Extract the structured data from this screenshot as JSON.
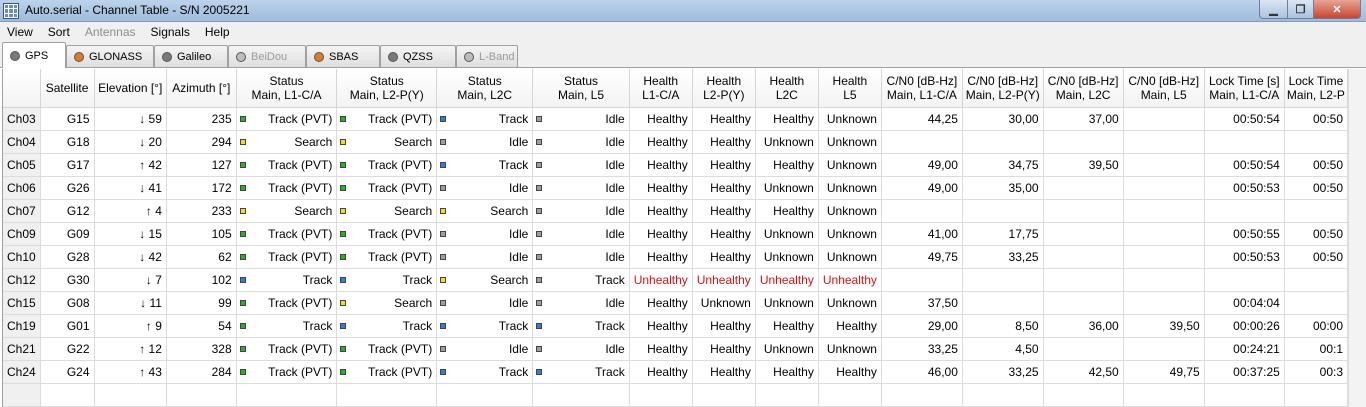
{
  "window": {
    "title": "Auto.serial - Channel Table - S/N 2005221"
  },
  "menu": [
    {
      "label": "View",
      "disabled": false
    },
    {
      "label": "Sort",
      "disabled": false
    },
    {
      "label": "Antennas",
      "disabled": true
    },
    {
      "label": "Signals",
      "disabled": false
    },
    {
      "label": "Help",
      "disabled": false
    }
  ],
  "tabs": [
    {
      "label": "GPS",
      "color": "#7a7a7a",
      "active": true,
      "disabled": false
    },
    {
      "label": "GLONASS",
      "color": "#e07a2a",
      "active": false,
      "disabled": false
    },
    {
      "label": "Galileo",
      "color": "#7a7a7a",
      "active": false,
      "disabled": false
    },
    {
      "label": "BeiDou",
      "color": "#bdbdbd",
      "active": false,
      "disabled": true
    },
    {
      "label": "SBAS",
      "color": "#e07a2a",
      "active": false,
      "disabled": false
    },
    {
      "label": "QZSS",
      "color": "#7a7a7a",
      "active": false,
      "disabled": false
    },
    {
      "label": "L-Band",
      "color": "#bdbdbd",
      "active": false,
      "disabled": true
    }
  ],
  "status_colors": {
    "green": "#21b521",
    "yellow": "#f0e020",
    "blue": "#2a7fdb",
    "gray": "#9e9e9e"
  },
  "columns": [
    [
      "",
      ""
    ],
    [
      "Satellite",
      ""
    ],
    [
      "Elevation [°]",
      ""
    ],
    [
      "Azimuth [°]",
      ""
    ],
    [
      "Status",
      "Main, L1-C/A"
    ],
    [
      "Status",
      "Main, L2-P(Y)"
    ],
    [
      "Status",
      "Main, L2C"
    ],
    [
      "Status",
      "Main, L5"
    ],
    [
      "Health",
      "L1-C/A"
    ],
    [
      "Health",
      "L2-P(Y)"
    ],
    [
      "Health",
      "L2C"
    ],
    [
      "Health",
      "L5"
    ],
    [
      "C/N0 [dB-Hz]",
      "Main, L1-C/A"
    ],
    [
      "C/N0 [dB-Hz]",
      "Main, L2-P(Y)"
    ],
    [
      "C/N0 [dB-Hz]",
      "Main, L2C"
    ],
    [
      "C/N0 [dB-Hz]",
      "Main, L5"
    ],
    [
      "Lock Time [s]",
      "Main, L1-C/A"
    ],
    [
      "Lock Time",
      "Main, L2-P"
    ]
  ],
  "rows": [
    {
      "ch": "Ch03",
      "sat": "G15",
      "elev": "↓ 59",
      "az": "235",
      "st": [
        [
          "green",
          "Track (PVT)"
        ],
        [
          "green",
          "Track (PVT)"
        ],
        [
          "blue",
          "Track"
        ],
        [
          "gray",
          "Idle"
        ]
      ],
      "health": [
        "Healthy",
        "Healthy",
        "Healthy",
        "Unknown"
      ],
      "cn0": [
        "44,25",
        "30,00",
        "37,00",
        ""
      ],
      "lock": [
        "00:50:54",
        "00:50"
      ]
    },
    {
      "ch": "Ch04",
      "sat": "G18",
      "elev": "↓ 20",
      "az": "294",
      "st": [
        [
          "yellow",
          "Search"
        ],
        [
          "yellow",
          "Search"
        ],
        [
          "gray",
          "Idle"
        ],
        [
          "gray",
          "Idle"
        ]
      ],
      "health": [
        "Healthy",
        "Healthy",
        "Unknown",
        "Unknown"
      ],
      "cn0": [
        "",
        "",
        "",
        ""
      ],
      "lock": [
        "",
        ""
      ]
    },
    {
      "ch": "Ch05",
      "sat": "G17",
      "elev": "↑ 42",
      "az": "127",
      "st": [
        [
          "green",
          "Track (PVT)"
        ],
        [
          "green",
          "Track (PVT)"
        ],
        [
          "blue",
          "Track"
        ],
        [
          "gray",
          "Idle"
        ]
      ],
      "health": [
        "Healthy",
        "Healthy",
        "Healthy",
        "Unknown"
      ],
      "cn0": [
        "49,00",
        "34,75",
        "39,50",
        ""
      ],
      "lock": [
        "00:50:54",
        "00:50"
      ]
    },
    {
      "ch": "Ch06",
      "sat": "G26",
      "elev": "↓ 41",
      "az": "172",
      "st": [
        [
          "green",
          "Track (PVT)"
        ],
        [
          "green",
          "Track (PVT)"
        ],
        [
          "gray",
          "Idle"
        ],
        [
          "gray",
          "Idle"
        ]
      ],
      "health": [
        "Healthy",
        "Healthy",
        "Unknown",
        "Unknown"
      ],
      "cn0": [
        "49,00",
        "35,00",
        "",
        ""
      ],
      "lock": [
        "00:50:53",
        "00:50"
      ]
    },
    {
      "ch": "Ch07",
      "sat": "G12",
      "elev": "↑ 4",
      "az": "233",
      "st": [
        [
          "yellow",
          "Search"
        ],
        [
          "yellow",
          "Search"
        ],
        [
          "yellow",
          "Search"
        ],
        [
          "gray",
          "Idle"
        ]
      ],
      "health": [
        "Healthy",
        "Healthy",
        "Healthy",
        "Unknown"
      ],
      "cn0": [
        "",
        "",
        "",
        ""
      ],
      "lock": [
        "",
        ""
      ]
    },
    {
      "ch": "Ch09",
      "sat": "G09",
      "elev": "↓ 15",
      "az": "105",
      "st": [
        [
          "green",
          "Track (PVT)"
        ],
        [
          "green",
          "Track (PVT)"
        ],
        [
          "gray",
          "Idle"
        ],
        [
          "gray",
          "Idle"
        ]
      ],
      "health": [
        "Healthy",
        "Healthy",
        "Unknown",
        "Unknown"
      ],
      "cn0": [
        "41,00",
        "17,75",
        "",
        ""
      ],
      "lock": [
        "00:50:55",
        "00:50"
      ]
    },
    {
      "ch": "Ch10",
      "sat": "G28",
      "elev": "↓ 42",
      "az": "62",
      "st": [
        [
          "green",
          "Track (PVT)"
        ],
        [
          "green",
          "Track (PVT)"
        ],
        [
          "gray",
          "Idle"
        ],
        [
          "gray",
          "Idle"
        ]
      ],
      "health": [
        "Healthy",
        "Healthy",
        "Unknown",
        "Unknown"
      ],
      "cn0": [
        "49,75",
        "33,25",
        "",
        ""
      ],
      "lock": [
        "00:50:53",
        "00:50"
      ]
    },
    {
      "ch": "Ch12",
      "sat": "G30",
      "elev": "↓ 7",
      "az": "102",
      "st": [
        [
          "blue",
          "Track"
        ],
        [
          "blue",
          "Track"
        ],
        [
          "yellow",
          "Search"
        ],
        [
          "gray",
          "Track"
        ]
      ],
      "health": [
        "Unhealthy",
        "Unhealthy",
        "Unhealthy",
        "Unhealthy"
      ],
      "cn0": [
        "",
        "",
        "",
        ""
      ],
      "lock": [
        "",
        ""
      ]
    },
    {
      "ch": "Ch15",
      "sat": "G08",
      "elev": "↓ 11",
      "az": "99",
      "st": [
        [
          "green",
          "Track (PVT)"
        ],
        [
          "yellow",
          "Search"
        ],
        [
          "gray",
          "Idle"
        ],
        [
          "gray",
          "Idle"
        ]
      ],
      "health": [
        "Healthy",
        "Unknown",
        "Unknown",
        "Unknown"
      ],
      "cn0": [
        "37,50",
        "",
        "",
        ""
      ],
      "lock": [
        "00:04:04",
        ""
      ]
    },
    {
      "ch": "Ch19",
      "sat": "G01",
      "elev": "↑ 9",
      "az": "54",
      "st": [
        [
          "green",
          "Track"
        ],
        [
          "blue",
          "Track"
        ],
        [
          "blue",
          "Track"
        ],
        [
          "blue",
          "Track"
        ]
      ],
      "health": [
        "Healthy",
        "Healthy",
        "Healthy",
        "Healthy"
      ],
      "cn0": [
        "29,00",
        "8,50",
        "36,00",
        "39,50"
      ],
      "lock": [
        "00:00:26",
        "00:00"
      ]
    },
    {
      "ch": "Ch21",
      "sat": "G22",
      "elev": "↑ 12",
      "az": "328",
      "st": [
        [
          "green",
          "Track (PVT)"
        ],
        [
          "green",
          "Track (PVT)"
        ],
        [
          "gray",
          "Idle"
        ],
        [
          "gray",
          "Idle"
        ]
      ],
      "health": [
        "Healthy",
        "Healthy",
        "Unknown",
        "Unknown"
      ],
      "cn0": [
        "33,25",
        "4,50",
        "",
        ""
      ],
      "lock": [
        "00:24:21",
        "00:1"
      ]
    },
    {
      "ch": "Ch24",
      "sat": "G24",
      "elev": "↑ 43",
      "az": "284",
      "st": [
        [
          "green",
          "Track (PVT)"
        ],
        [
          "green",
          "Track (PVT)"
        ],
        [
          "blue",
          "Track"
        ],
        [
          "blue",
          "Track"
        ]
      ],
      "health": [
        "Healthy",
        "Healthy",
        "Healthy",
        "Healthy"
      ],
      "cn0": [
        "46,00",
        "33,25",
        "42,50",
        "49,75"
      ],
      "lock": [
        "00:37:25",
        "00:3"
      ]
    }
  ]
}
